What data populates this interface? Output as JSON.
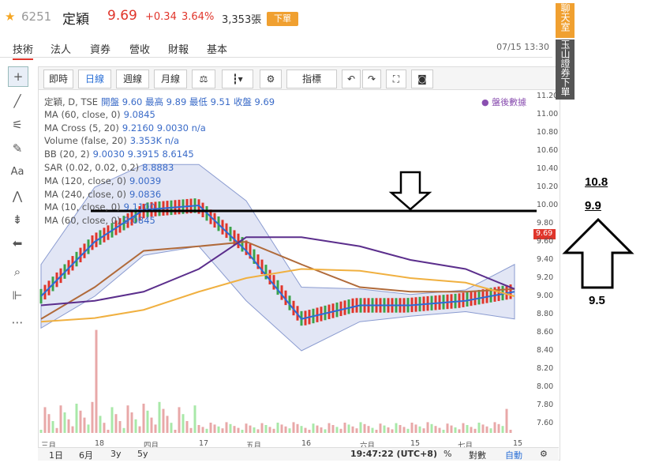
{
  "header": {
    "stock_code": "6251",
    "stock_name": "定穎",
    "price": "9.69",
    "change": "+0.34",
    "change_pct": "3.64%",
    "volume": "3,353張",
    "order_button": "下單"
  },
  "nav": {
    "tabs": [
      "技術",
      "法人",
      "資券",
      "營收",
      "財報",
      "基本"
    ],
    "active": "技術",
    "timestamp": "07/15 13:30"
  },
  "toolbar": {
    "buttons": [
      "即時",
      "日線",
      "週線",
      "月線"
    ],
    "active": "日線",
    "indicator_label": "指標"
  },
  "legend": [
    {
      "text": "定穎, D, TSE",
      "values": "開盤 9.60 最高 9.89 最低 9.51 收盤 9.69"
    },
    {
      "text": "MA (60, close, 0)",
      "values": "9.0845"
    },
    {
      "text": "MA Cross (5, 20)",
      "values": "9.2160 9.0030 n/a"
    },
    {
      "text": "Volume (false, 20)",
      "values": "3.353K n/a"
    },
    {
      "text": "BB (20, 2)",
      "values": "9.0030 9.3915 8.6145"
    },
    {
      "text": "SAR (0.02, 0.02, 0.2)",
      "values": "8.8883"
    },
    {
      "text": "MA (120, close, 0)",
      "values": "9.0039"
    },
    {
      "text": "MA (240, close, 0)",
      "values": "9.0836"
    },
    {
      "text": "MA (10, close, 0)",
      "values": "9.1100"
    },
    {
      "text": "MA (60, close, 0)",
      "values": "9.0845"
    }
  ],
  "after_hours_label": "盤後數據",
  "y_axis_labels": [
    "11.20",
    "11.00",
    "10.80",
    "10.60",
    "10.40",
    "10.20",
    "10.00",
    "9.80",
    "9.60",
    "9.40",
    "9.20",
    "9.00",
    "8.80",
    "8.60",
    "8.40",
    "8.20",
    "8.00",
    "7.80",
    "7.60"
  ],
  "current_price_tag": "9.69",
  "x_axis_labels": [
    "三月",
    "18",
    "四月",
    "17",
    "五月",
    "16",
    "六月",
    "15",
    "七月",
    "15"
  ],
  "bottom_bar": {
    "ranges": [
      "1日",
      "6月",
      "3y",
      "5y"
    ],
    "clock": "19:47:22 (UTC+8)",
    "pct": "%",
    "log": "對數",
    "auto": "自動"
  },
  "right_badges": [
    "聊天室",
    "玉山證券下單"
  ],
  "annotations": {
    "top": "10.8",
    "mid": "9.9",
    "low": "9.5"
  },
  "colors": {
    "up": "#e0352b",
    "down": "#3aa34a",
    "ma_blue": "#2d6bd6",
    "ma_purple": "#5b2e8c",
    "ma_orange": "#f0b040",
    "ma_brown": "#b06a3a",
    "band_fill": "#cfd6ee"
  },
  "chart_data": {
    "type": "line",
    "title": "定穎, D, TSE",
    "ylim": [
      7.5,
      11.25
    ],
    "x": [
      "三月",
      "18",
      "四月",
      "17",
      "五月",
      "16",
      "六月",
      "15",
      "七月",
      "15"
    ],
    "series": [
      {
        "name": "MA (10, close, 0)",
        "values": [
          9.0,
          9.6,
          9.95,
          10.0,
          9.5,
          8.75,
          8.9,
          8.9,
          8.95,
          9.05
        ]
      },
      {
        "name": "MA (60, close, 0)",
        "values": [
          8.75,
          9.1,
          9.5,
          9.55,
          9.6,
          9.35,
          9.1,
          9.05,
          9.05,
          9.08
        ]
      },
      {
        "name": "MA (240, close, 0)",
        "values": [
          8.9,
          8.95,
          9.05,
          9.3,
          9.65,
          9.65,
          9.55,
          9.4,
          9.3,
          9.08
        ]
      },
      {
        "name": "MA (120, close, 0)",
        "values": [
          8.72,
          8.76,
          8.85,
          9.05,
          9.2,
          9.3,
          9.28,
          9.2,
          9.15,
          9.0
        ]
      }
    ]
  }
}
